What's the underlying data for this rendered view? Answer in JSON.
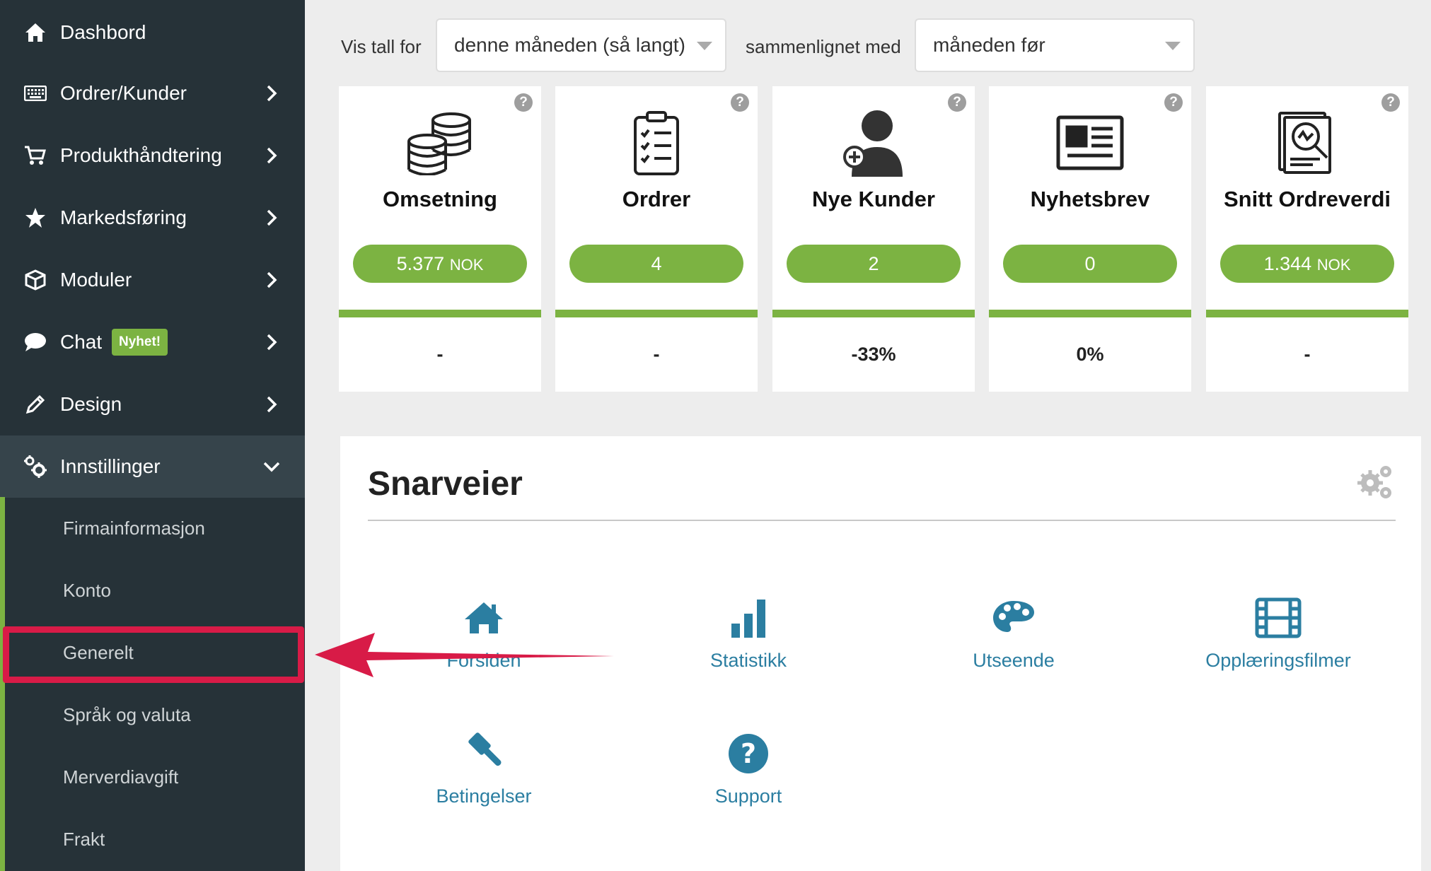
{
  "sidebar": {
    "items": [
      {
        "label": "Dashbord",
        "icon": "home-icon"
      },
      {
        "label": "Ordrer/Kunder",
        "icon": "keyboard-icon"
      },
      {
        "label": "Produkthåndtering",
        "icon": "cart-icon"
      },
      {
        "label": "Markedsføring",
        "icon": "star-icon"
      },
      {
        "label": "Moduler",
        "icon": "cube-icon"
      },
      {
        "label": "Chat",
        "icon": "chat-icon",
        "badge": "Nyhet!"
      },
      {
        "label": "Design",
        "icon": "pencil-icon"
      },
      {
        "label": "Innstillinger",
        "icon": "cogs-icon"
      }
    ],
    "subitems": [
      "Firmainformasjon",
      "Konto",
      "Generelt",
      "Språk og valuta",
      "Merverdiavgift",
      "Frakt"
    ],
    "highlighted": "Generelt"
  },
  "filters": {
    "label1": "Vis tall for",
    "select1": "denne måneden (så langt)",
    "label2": "sammenlignet med",
    "select2": "måneden før"
  },
  "cards": [
    {
      "title": "Omsetning",
      "value": "5.377",
      "unit": "NOK",
      "change": "-",
      "icon": "coins-icon"
    },
    {
      "title": "Ordrer",
      "value": "4",
      "unit": "",
      "change": "-",
      "icon": "clipboard-icon"
    },
    {
      "title": "Nye Kunder",
      "value": "2",
      "unit": "",
      "change": "-33%",
      "icon": "add-user-icon"
    },
    {
      "title": "Nyhetsbrev",
      "value": "0",
      "unit": "",
      "change": "0%",
      "icon": "newspaper-icon"
    },
    {
      "title": "Snitt Ordreverdi",
      "value": "1.344",
      "unit": "NOK",
      "change": "-",
      "icon": "report-search-icon"
    }
  ],
  "shortcuts": {
    "title": "Snarveier",
    "items": [
      {
        "label": "Forsiden",
        "icon": "home-icon"
      },
      {
        "label": "Statistikk",
        "icon": "bar-chart-icon"
      },
      {
        "label": "Utseende",
        "icon": "palette-icon"
      },
      {
        "label": "Opplæringsfilmer",
        "icon": "film-icon"
      },
      {
        "label": "Betingelser",
        "icon": "gavel-icon"
      },
      {
        "label": "Support",
        "icon": "question-icon"
      }
    ]
  },
  "colors": {
    "sidebar": "#263238",
    "accent": "#7cb342",
    "link": "#2b7ea1",
    "highlight": "#d81b47"
  }
}
